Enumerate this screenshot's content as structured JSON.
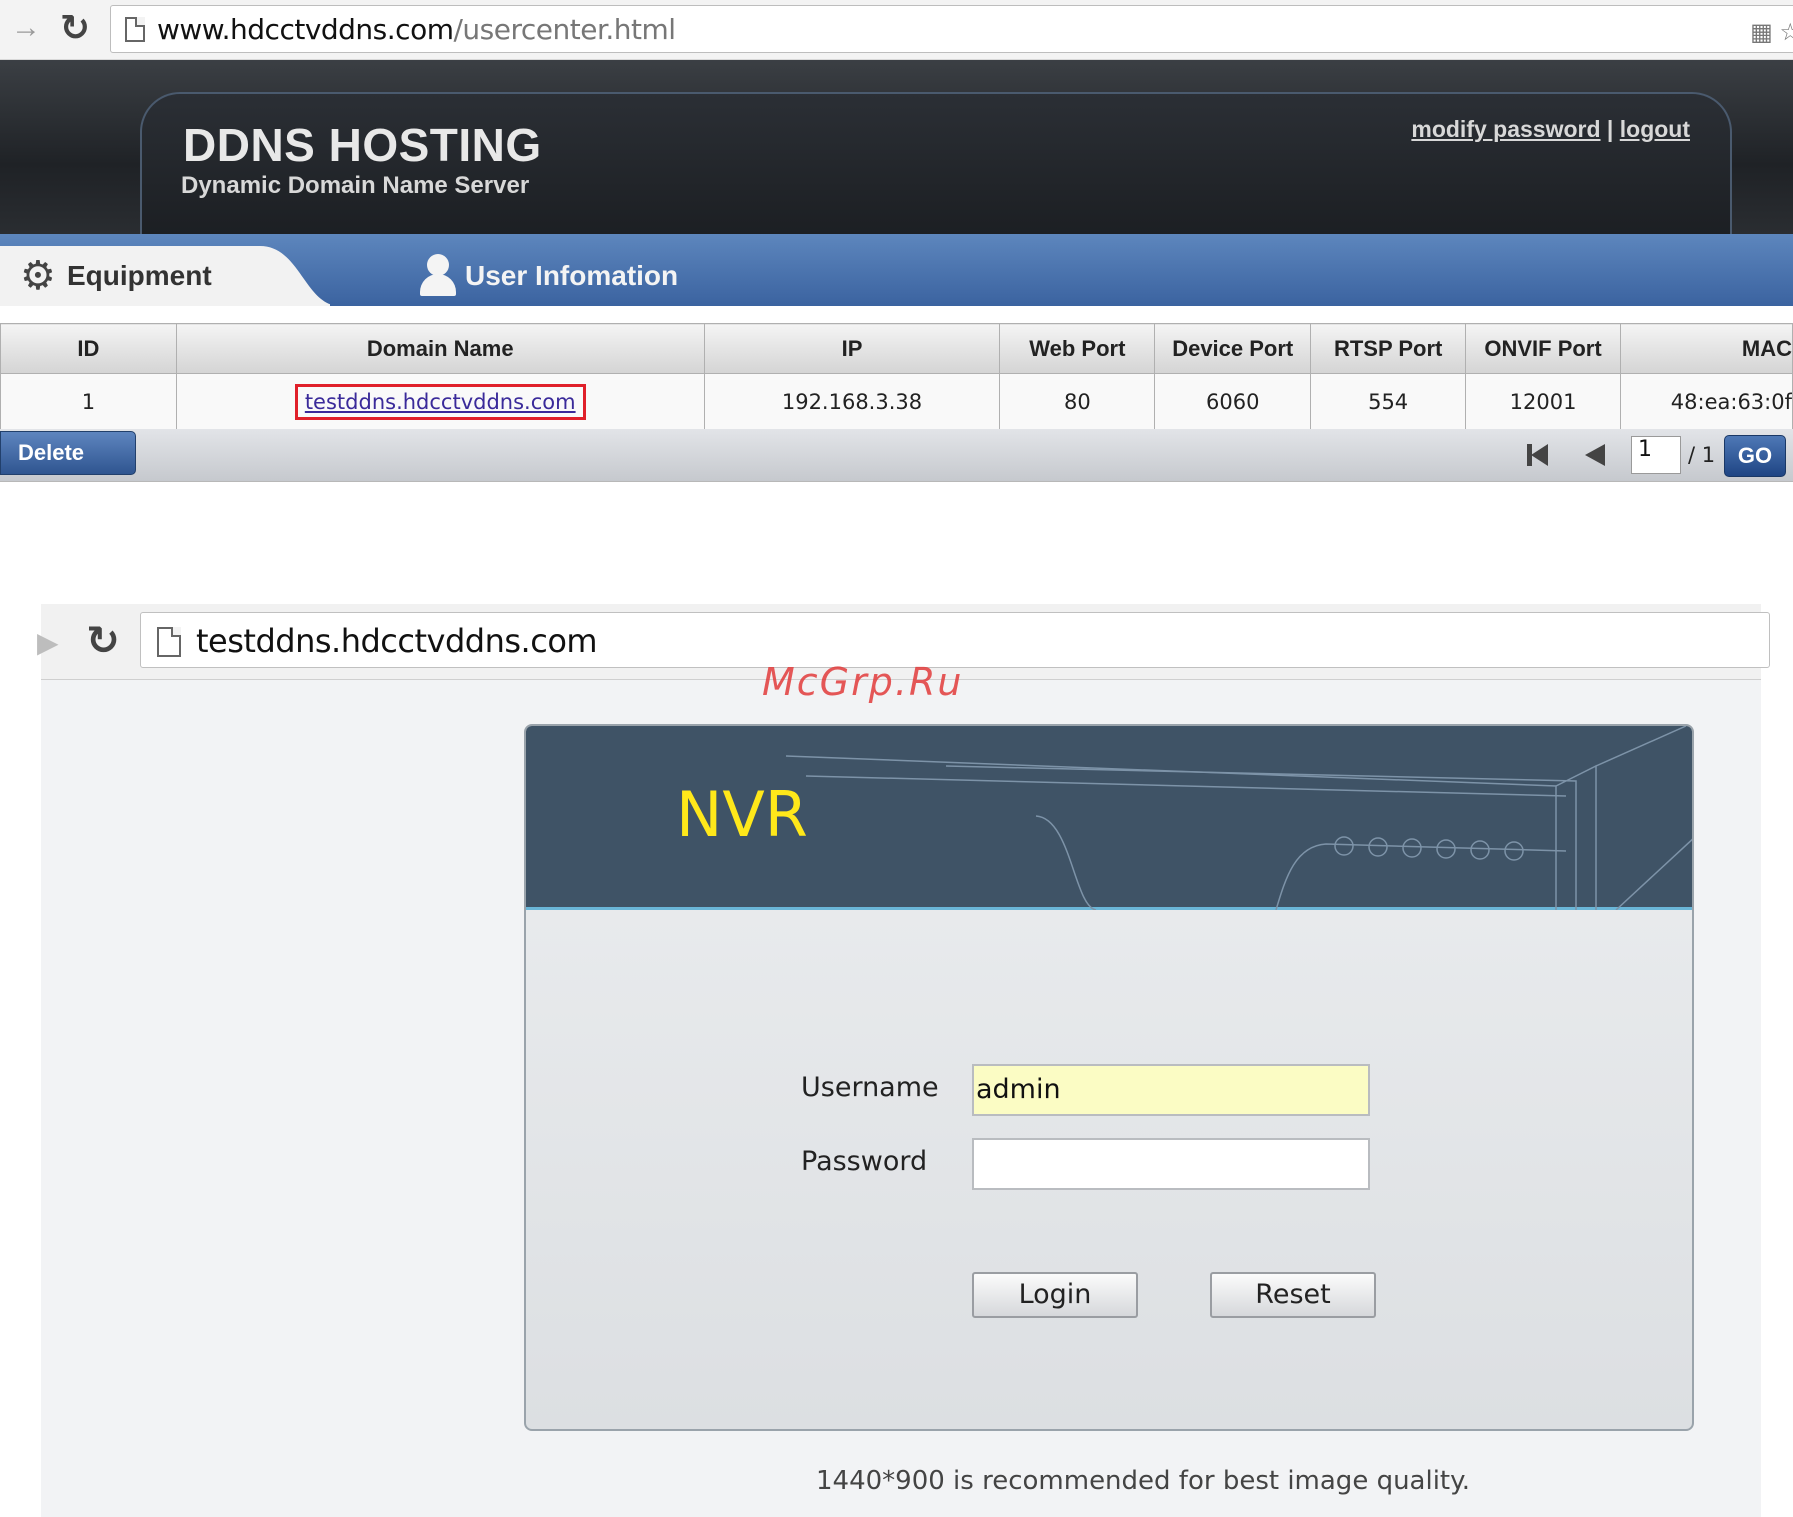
{
  "browser_top": {
    "url_host": "www.hdcctvddns.com",
    "url_path": "/usercenter.html"
  },
  "ddns": {
    "title": "DDNS HOSTING",
    "subtitle": "Dynamic Domain Name Server",
    "link_modify_password": "modify password",
    "link_separator": "|",
    "link_logout": "logout"
  },
  "tabs": {
    "equipment": "Equipment",
    "user_info": "User Infomation"
  },
  "table": {
    "headers": [
      "ID",
      "Domain Name",
      "IP",
      "Web Port",
      "Device Port",
      "RTSP Port",
      "ONVIF Port",
      "MAC"
    ],
    "rows": [
      {
        "id": "1",
        "domain": "testddns.hdcctvddns.com",
        "ip": "192.168.3.38",
        "web_port": "80",
        "device_port": "6060",
        "rtsp_port": "554",
        "onvif_port": "12001",
        "mac": "48:ea:63:0f"
      }
    ],
    "delete_label": "Delete",
    "page_value": "1",
    "page_total": "/ 1",
    "go_label": "GO"
  },
  "browser_second": {
    "url": "testddns.hdcctvddns.com"
  },
  "nvr": {
    "title": "NVR",
    "username_label": "Username",
    "username_value": "admin",
    "password_label": "Password",
    "password_value": "",
    "login_label": "Login",
    "reset_label": "Reset",
    "hint": "1440*900 is recommended for best image quality."
  },
  "watermark": "McGrp.Ru",
  "colors": {
    "nvr_title": "#ffe81a",
    "banner": "#3f5366",
    "tab_bar": "#4a74b0",
    "highlight_box": "#e0202a",
    "username_fill": "#fbfcc4"
  },
  "icons": {
    "forward": "forward-arrow-icon",
    "reload": "reload-icon",
    "page": "page-icon",
    "gear": "gear-icon",
    "user": "user-icon",
    "first_page": "first-page-icon",
    "prev_page": "prev-page-icon"
  }
}
